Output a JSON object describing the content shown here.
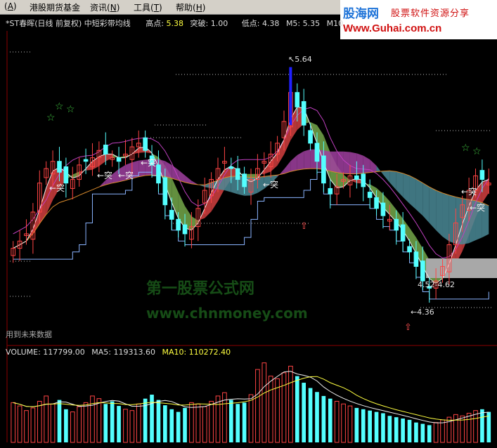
{
  "menu": [
    {
      "key": "A",
      "label": ""
    },
    {
      "key": "",
      "label": "港股期货基金"
    },
    {
      "key": "N",
      "label": "资讯"
    },
    {
      "key": "T",
      "label": "工具"
    },
    {
      "key": "H",
      "label": "帮助"
    }
  ],
  "logo": {
    "line1": "股海网",
    "line1b": "股票软件资源分享",
    "line2": "Www.Guhai.com.cn"
  },
  "header": {
    "stock": "*ST春晖(日线 前复权) 中短彩带均线",
    "high_label": "高点:",
    "high_value": "5.38",
    "break_label": "突破:",
    "break_value": "1.00",
    "low_label": "低点:",
    "low_value": "4.38",
    "m5_label": "M5:",
    "m5_value": "5.35",
    "m10_label": "M10"
  },
  "watermark": {
    "cn": "第一股票公式网",
    "url": "www.chnmoney.com"
  },
  "footer_note": "用到未来数据",
  "volume_header": {
    "volume": "VOLUME: 117799.00",
    "ma5": "MA5: 119313.60",
    "ma10": "MA10: 110272.40"
  },
  "colors": {
    "up": "#ff4444",
    "down": "#54ffff",
    "band_red": "#c83c3c",
    "band_green": "#6e9e46",
    "band_purple": "#a040a0",
    "band_teal": "#4a8a96",
    "ma_orange": "#d88a2c",
    "step": "#8ab4ff"
  },
  "chart_data": {
    "type": "candlestick",
    "labels": {
      "high": "5.64",
      "low": "4.36",
      "range": "4.52-4.62",
      "break": "突"
    },
    "price_closes": [
      4.62,
      4.66,
      4.7,
      4.82,
      4.98,
      5.06,
      5.1,
      5.04,
      4.98,
      5.0,
      5.08,
      5.1,
      5.12,
      5.16,
      5.14,
      5.12,
      5.1,
      5.14,
      5.18,
      5.2,
      5.16,
      5.08,
      4.98,
      4.86,
      4.78,
      4.72,
      4.7,
      4.74,
      4.84,
      4.94,
      5.0,
      5.06,
      5.1,
      5.06,
      5.0,
      4.96,
      5.0,
      5.06,
      5.1,
      5.14,
      5.2,
      5.32,
      5.48,
      5.4,
      5.3,
      5.2,
      5.1,
      4.98,
      4.92,
      4.96,
      5.0,
      5.02,
      5.0,
      4.96,
      4.9,
      4.84,
      4.8,
      4.78,
      4.72,
      4.66,
      4.6,
      4.52,
      4.44,
      4.4,
      4.44,
      4.52,
      4.64,
      4.76,
      4.86,
      4.94,
      5.02,
      5.0,
      4.98
    ],
    "volume_values": [
      60,
      55,
      48,
      52,
      62,
      70,
      58,
      64,
      50,
      46,
      54,
      60,
      70,
      66,
      58,
      62,
      55,
      50,
      48,
      58,
      66,
      72,
      64,
      56,
      50,
      46,
      52,
      60,
      58,
      54,
      62,
      70,
      75,
      64,
      58,
      60,
      72,
      110,
      120,
      100,
      96,
      105,
      115,
      100,
      90,
      82,
      76,
      70,
      66,
      62,
      58,
      55,
      52,
      50,
      48,
      46,
      44,
      40,
      38,
      36,
      34,
      30,
      28,
      26,
      30,
      34,
      38,
      42,
      40,
      44,
      48,
      50,
      46
    ],
    "volume_series": [
      {
        "name": "MA5",
        "value": "119313.60"
      },
      {
        "name": "MA10",
        "value": "110272.40"
      }
    ]
  }
}
